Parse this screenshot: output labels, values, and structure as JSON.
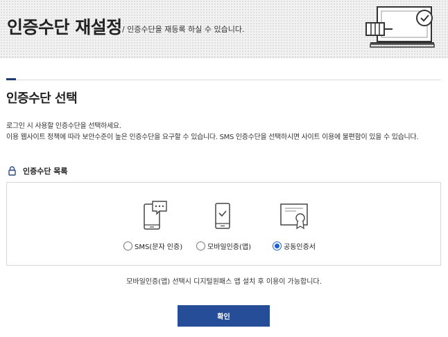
{
  "header": {
    "title": "인증수단 재설정",
    "subtitle": "/ 인증수단을 재등록 하실 수 있습니다."
  },
  "section": {
    "title": "인증수단 선택",
    "desc_line1": "로그인 시 사용할 인증수단을 선택하세요.",
    "desc_line2": "이용 웹사이트 정책에 따라 보안수준이 높은 인증수단을 요구할 수 있습니다. SMS 인증수단을 선택하시면 사이트 이용에 불편함이 있을 수 있습니다."
  },
  "method_list": {
    "title": "인증수단 목록",
    "options": [
      {
        "label": "SMS(문자 인증)",
        "icon": "sms-phone-icon",
        "selected": false
      },
      {
        "label": "모바일인증(앱)",
        "icon": "mobile-app-icon",
        "selected": false
      },
      {
        "label": "공동인증서",
        "icon": "certificate-icon",
        "selected": true
      }
    ]
  },
  "notice": "모바일인증(앱) 선택시 디지털원패스 앱 설치 후 이용이 가능합니다.",
  "confirm_label": "확인",
  "colors": {
    "primary_button": "#264d97",
    "section_marker": "#1f3b73",
    "radio_checked": "#1a5fd6"
  }
}
